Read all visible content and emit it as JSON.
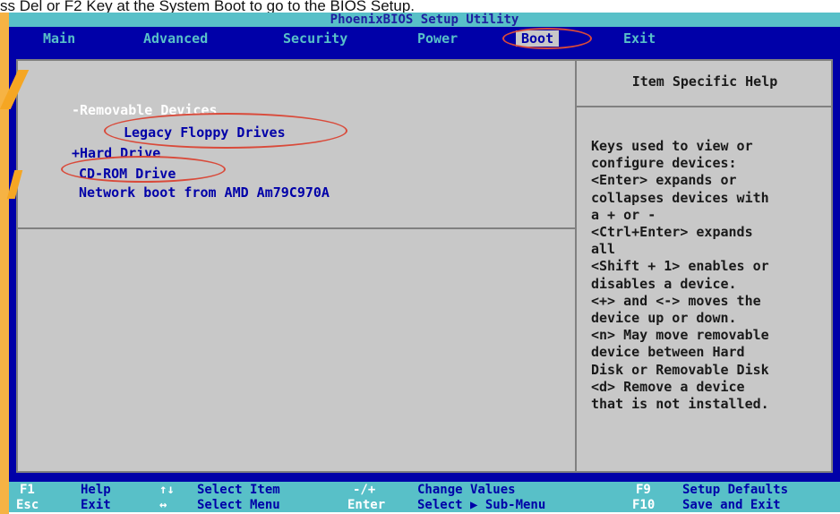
{
  "caption": "ss Del or F2 Key at the System Boot to go to the BIOS Setup.",
  "title": "PhoenixBIOS Setup Utility",
  "menu": [
    "Main",
    "Advanced",
    "Security",
    "Power",
    "Boot",
    "Exit"
  ],
  "active_menu": "Boot",
  "boot_list": {
    "header": "-Removable Devices",
    "items": [
      "Legacy Floppy Drives",
      "+Hard Drive",
      "CD-ROM Drive",
      "Network boot from AMD Am79C970A"
    ]
  },
  "help": {
    "title": "Item Specific Help",
    "lines": [
      "Keys used to view or",
      "configure devices:",
      "<Enter> expands or",
      "collapses devices with",
      "a + or -",
      "<Ctrl+Enter> expands",
      "all",
      "<Shift + 1> enables or",
      "disables a device.",
      "<+> and <-> moves the",
      "device up or down.",
      "<n> May move removable",
      "device between Hard",
      "Disk or Removable Disk",
      "<d> Remove a device",
      "that is not installed."
    ]
  },
  "footer": {
    "row1": [
      {
        "key": "F1",
        "desc": "Help"
      },
      {
        "key": "↑↓",
        "desc": "Select Item"
      },
      {
        "key": "-/+",
        "desc": "Change Values"
      },
      {
        "key": "F9",
        "desc": "Setup Defaults"
      }
    ],
    "row2": [
      {
        "key": "Esc",
        "desc": "Exit"
      },
      {
        "key": "↔",
        "desc": "Select Menu"
      },
      {
        "key": "Enter",
        "desc": "Select ▶ Sub-Menu"
      },
      {
        "key": "F10",
        "desc": "Save and Exit"
      }
    ]
  },
  "colors": {
    "bios_blue": "#0000a8",
    "cyan": "#58c0c8",
    "panel_gray": "#c8c8c8",
    "highlight_red": "#d94a3a",
    "watermark_orange": "#f5a623"
  }
}
